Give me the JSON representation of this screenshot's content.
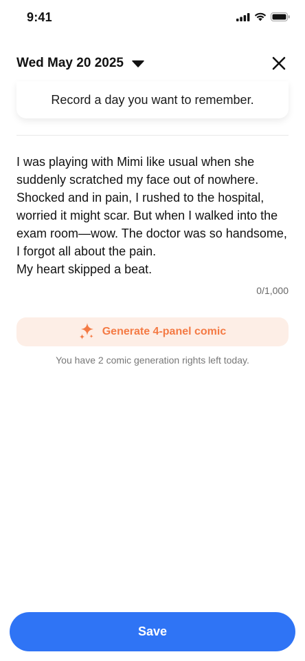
{
  "status_bar": {
    "time": "9:41",
    "icons": [
      "cellular-signal-icon",
      "wifi-icon",
      "battery-icon"
    ]
  },
  "header": {
    "date": "Wed May 20 2025",
    "dropdown_icon": "caret-down-icon",
    "close_icon": "close-icon"
  },
  "prompt": {
    "text": "Record a day you want to remember."
  },
  "entry": {
    "text": "I was playing with Mimi like usual when she suddenly scratched my face out of nowhere. Shocked and in pain, I rushed to the hospital, worried it might scar. But when I walked into the exam room—wow. The doctor was so handsome, I forgot all about the pain.\nMy heart skipped a beat.",
    "char_count": "0/1,000"
  },
  "comic": {
    "button_label": "Generate 4-panel comic",
    "icon": "sparkles-icon",
    "rights_text": "You have 2 comic generation rights left today."
  },
  "footer": {
    "save_label": "Save"
  },
  "colors": {
    "accent_blue": "#2f74f5",
    "accent_orange": "#f47a44",
    "orange_bg": "#fdeee6"
  }
}
